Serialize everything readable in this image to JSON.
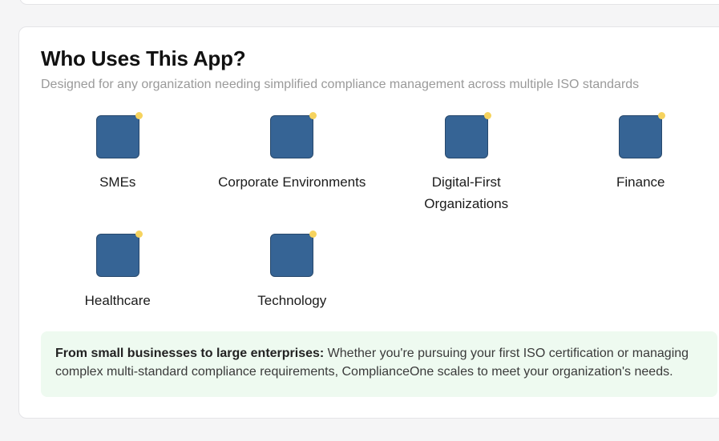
{
  "section": {
    "title": "Who Uses This App?",
    "subtitle": "Designed for any organization needing simplified compliance management across multiple ISO standards"
  },
  "audiences": [
    {
      "label": "SMEs"
    },
    {
      "label": "Corporate Environments"
    },
    {
      "label": "Digital-First Organizations"
    },
    {
      "label": "Finance"
    },
    {
      "label": "Healthcare"
    },
    {
      "label": "Technology"
    }
  ],
  "note": {
    "lead": "From small businesses to large enterprises:",
    "body": " Whether you're pursuing your first ISO certification or managing complex multi-standard compliance requirements, ComplianceOne scales to meet your organization's needs."
  },
  "colors": {
    "tile": "#366495",
    "dot": "#f6d35e",
    "note_bg": "#eefaf0"
  },
  "icons": {
    "tile": "audience-tile-icon",
    "dot": "indicator-dot-icon"
  }
}
